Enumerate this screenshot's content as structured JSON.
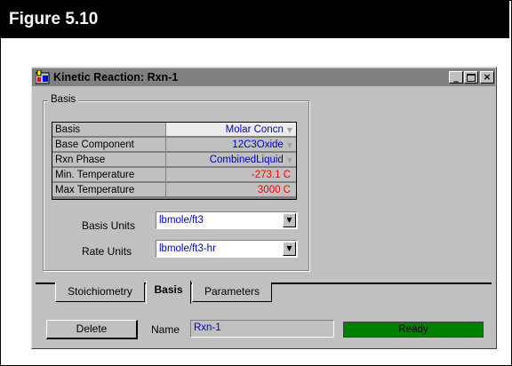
{
  "figure": {
    "title": "Figure 5.10"
  },
  "window": {
    "title": "Kinetic Reaction: Rxn-1",
    "minimize": "_",
    "maximize": "□",
    "close": "×"
  },
  "basis_group": {
    "label": "Basis",
    "rows": [
      {
        "label": "Basis",
        "value": "Molar Concn",
        "dropdown": true
      },
      {
        "label": "Base Component",
        "value": "12C3Oxide",
        "dropdown": true
      },
      {
        "label": "Rxn Phase",
        "value": "CombinedLiquid",
        "dropdown": true
      },
      {
        "label": "Min. Temperature",
        "value": "-273.1 C",
        "dropdown": false
      },
      {
        "label": "Max Temperature",
        "value": "3000 C",
        "dropdown": false
      }
    ],
    "basis_units": {
      "label": "Basis Units",
      "value": "lbmole/ft3"
    },
    "rate_units": {
      "label": "Rate Units",
      "value": "lbmole/ft3-hr"
    }
  },
  "tabs": [
    {
      "label": "Stoichiometry",
      "active": false
    },
    {
      "label": "Basis",
      "active": true
    },
    {
      "label": "Parameters",
      "active": false
    }
  ],
  "bottom": {
    "delete_label": "Delete",
    "name_label": "Name",
    "name_value": "Rxn-1",
    "status": "Ready"
  },
  "colors": {
    "status_ok": "#008000",
    "value_text": "#0000c8",
    "temperature_text": "#ff0000"
  },
  "icons": {
    "window_icon": "reaction-app-icon",
    "dropdown": "chevron-down-icon"
  }
}
